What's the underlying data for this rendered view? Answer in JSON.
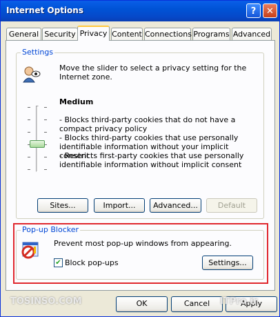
{
  "window": {
    "title": "Internet Options",
    "help_button": "?",
    "close_button": "✕"
  },
  "tabs": [
    {
      "label": "General"
    },
    {
      "label": "Security"
    },
    {
      "label": "Privacy"
    },
    {
      "label": "Content"
    },
    {
      "label": "Connections"
    },
    {
      "label": "Programs"
    },
    {
      "label": "Advanced"
    }
  ],
  "settings": {
    "group_label": "Settings",
    "description": "Move the slider to select a privacy setting for the Internet zone.",
    "level": "Medium",
    "bullet1": "- Blocks third-party cookies that do not have a compact privacy policy",
    "bullet2": "- Blocks third-party cookies that use personally identifiable information without your implicit consent",
    "bullet3": "- Restricts first-party cookies that use personally identifiable information without implicit consent",
    "slider_level": "4 of 6",
    "buttons": {
      "sites": "Sites...",
      "import": "Import...",
      "advanced": "Advanced...",
      "default": "Default"
    }
  },
  "popup_blocker": {
    "group_label": "Pop-up Blocker",
    "description": "Prevent most pop-up windows from appearing.",
    "checkbox_label": "Block pop-ups",
    "checked": true,
    "settings_button": "Settings..."
  },
  "footer": {
    "ok": "OK",
    "cancel": "Cancel",
    "apply": "Apply"
  },
  "watermarks": {
    "left": "TOSINSO.COM",
    "right": "ITPro.ir"
  }
}
